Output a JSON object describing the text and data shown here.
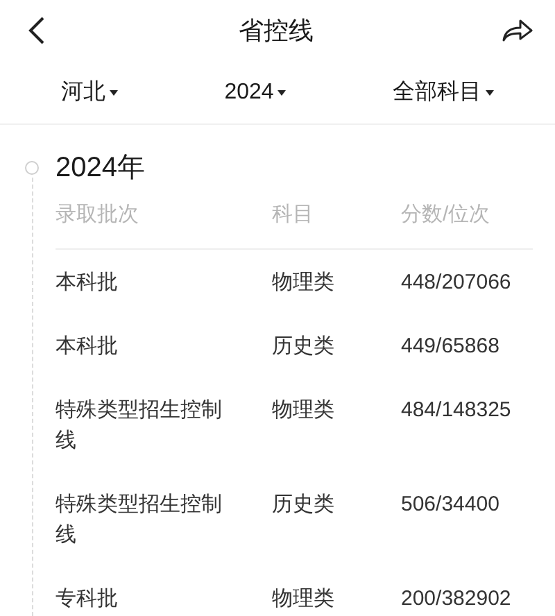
{
  "header": {
    "title": "省控线"
  },
  "filters": [
    {
      "label": "河北"
    },
    {
      "label": "2024"
    },
    {
      "label": "全部科目"
    }
  ],
  "section": {
    "year": "2024年",
    "columns": [
      "录取批次",
      "科目",
      "分数/位次"
    ],
    "rows": [
      {
        "batch": "本科批",
        "subject": "物理类",
        "score": "448/207066"
      },
      {
        "batch": "本科批",
        "subject": "历史类",
        "score": "449/65868"
      },
      {
        "batch": "特殊类型招生控制线",
        "subject": "物理类",
        "score": "484/148325"
      },
      {
        "batch": "特殊类型招生控制线",
        "subject": "历史类",
        "score": "506/34400"
      },
      {
        "batch": "专科批",
        "subject": "物理类",
        "score": "200/382902"
      }
    ]
  }
}
